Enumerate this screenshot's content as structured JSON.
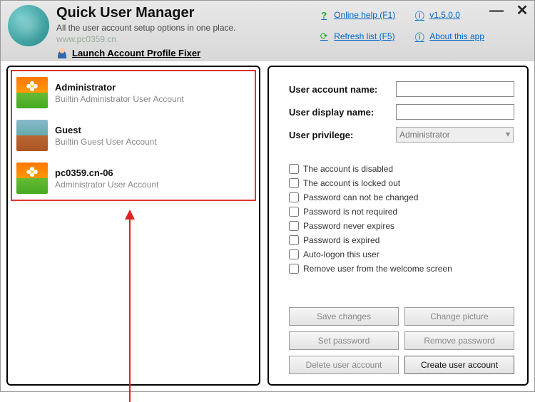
{
  "header": {
    "title": "Quick User Manager",
    "subtitle": "All the user account setup options in one place.",
    "watermark": "www.pc0359.cn",
    "launch_label": "Launch Account Profile Fixer",
    "links": {
      "help": "Online help (F1)",
      "version": "v1.5.0.0",
      "refresh": "Refresh list (F5)",
      "about": "About this app"
    }
  },
  "users": [
    {
      "name": "Administrator",
      "desc": "Builtin Administrator User Account",
      "avatar": "flower"
    },
    {
      "name": "Guest",
      "desc": "Builtin Guest User Account",
      "avatar": "suitcase"
    },
    {
      "name": "pc0359.cn-06",
      "desc": "Administrator User Account",
      "avatar": "flower"
    }
  ],
  "form": {
    "labels": {
      "account_name": "User account name:",
      "display_name": "User display name:",
      "privilege": "User privilege:"
    },
    "values": {
      "account_name": "",
      "display_name": "",
      "privilege": "Administrator"
    },
    "checks": [
      "The account is disabled",
      "The account is locked out",
      "Password can not be changed",
      "Password is not required",
      "Password never expires",
      "Password is expired",
      "Auto-logon this user",
      "Remove user from the welcome screen"
    ],
    "buttons": {
      "save": "Save changes",
      "change_pic": "Change picture",
      "set_pass": "Set password",
      "remove_pass": "Remove password",
      "delete": "Delete user account",
      "create": "Create user account"
    }
  }
}
